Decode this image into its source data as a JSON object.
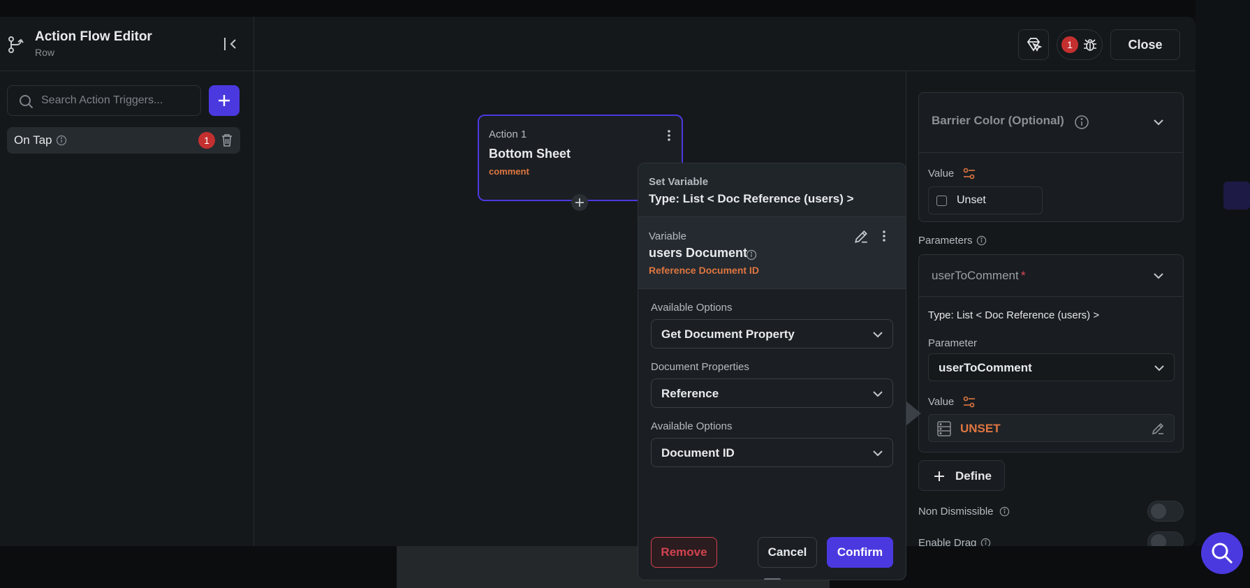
{
  "header": {
    "title": "Action Flow Editor",
    "subtitle": "Row"
  },
  "search": {
    "placeholder": "Search Action Triggers..."
  },
  "trigger": {
    "label": "On Tap",
    "badge": "1"
  },
  "toolbar": {
    "debug_badge": "1",
    "close_label": "Close"
  },
  "node": {
    "label": "Action 1",
    "title": "Bottom Sheet",
    "subtitle": "comment"
  },
  "popover": {
    "header_label": "Set Variable",
    "header_type": "Type: List < Doc Reference (users) >",
    "variable_label": "Variable",
    "variable_name": "users Document",
    "variable_sub": "Reference Document ID",
    "field1_label": "Available Options",
    "field1_value": "Get Document Property",
    "field2_label": "Document Properties",
    "field2_value": "Reference",
    "field3_label": "Available Options",
    "field3_value": "Document ID",
    "remove_label": "Remove",
    "cancel_label": "Cancel",
    "confirm_label": "Confirm"
  },
  "right_panel": {
    "barrier_title": "Barrier Color (Optional)",
    "value_label": "Value",
    "unset_label": "Unset",
    "parameters_label": "Parameters",
    "param_name": "userToComment",
    "param_required": "*",
    "param_type": "Type: List < Doc Reference (users) >",
    "parameter_label": "Parameter",
    "parameter_value": "userToComment",
    "value2_label": "Value",
    "unset_value": "UNSET",
    "define_label": "Define",
    "non_dismissible_label": "Non Dismissible",
    "enable_drag_label": "Enable Drag"
  },
  "colors": {
    "accent": "#4b39e0",
    "warning": "#e07640",
    "danger": "#c4302f"
  }
}
